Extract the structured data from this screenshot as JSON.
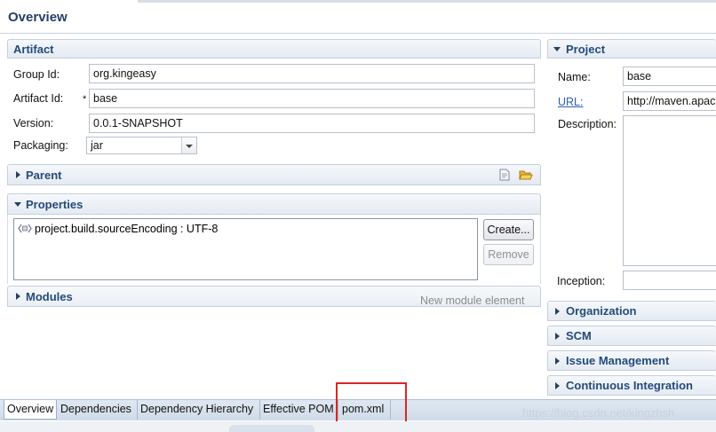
{
  "header": {
    "title": "Overview"
  },
  "artifact": {
    "title": "Artifact",
    "group_id_label": "Group Id:",
    "group_id_value": "org.kingeasy",
    "artifact_id_label": "Artifact Id:",
    "artifact_id_required": "*",
    "artifact_id_value": "base",
    "version_label": "Version:",
    "version_value": "0.0.1-SNAPSHOT",
    "packaging_label": "Packaging:",
    "packaging_value": "jar"
  },
  "parent": {
    "title": "Parent"
  },
  "properties": {
    "title": "Properties",
    "items": [
      "project.build.sourceEncoding : UTF-8"
    ],
    "create_label": "Create...",
    "remove_label": "Remove"
  },
  "modules": {
    "title": "Modules",
    "hint": "New module element"
  },
  "project": {
    "title": "Project",
    "name_label": "Name:",
    "name_value": "base",
    "url_label": "URL:",
    "url_value": "http://maven.apac",
    "description_label": "Description:",
    "description_value": "",
    "inception_label": "Inception:",
    "inception_value": ""
  },
  "collapsed_sections": [
    "Organization",
    "SCM",
    "Issue Management",
    "Continuous Integration"
  ],
  "tabs": [
    "Overview",
    "Dependencies",
    "Dependency Hierarchy",
    "Effective POM",
    "pom.xml"
  ],
  "active_tab": "Overview",
  "watermark": "https://blog.csdn.net/kingzhsh"
}
